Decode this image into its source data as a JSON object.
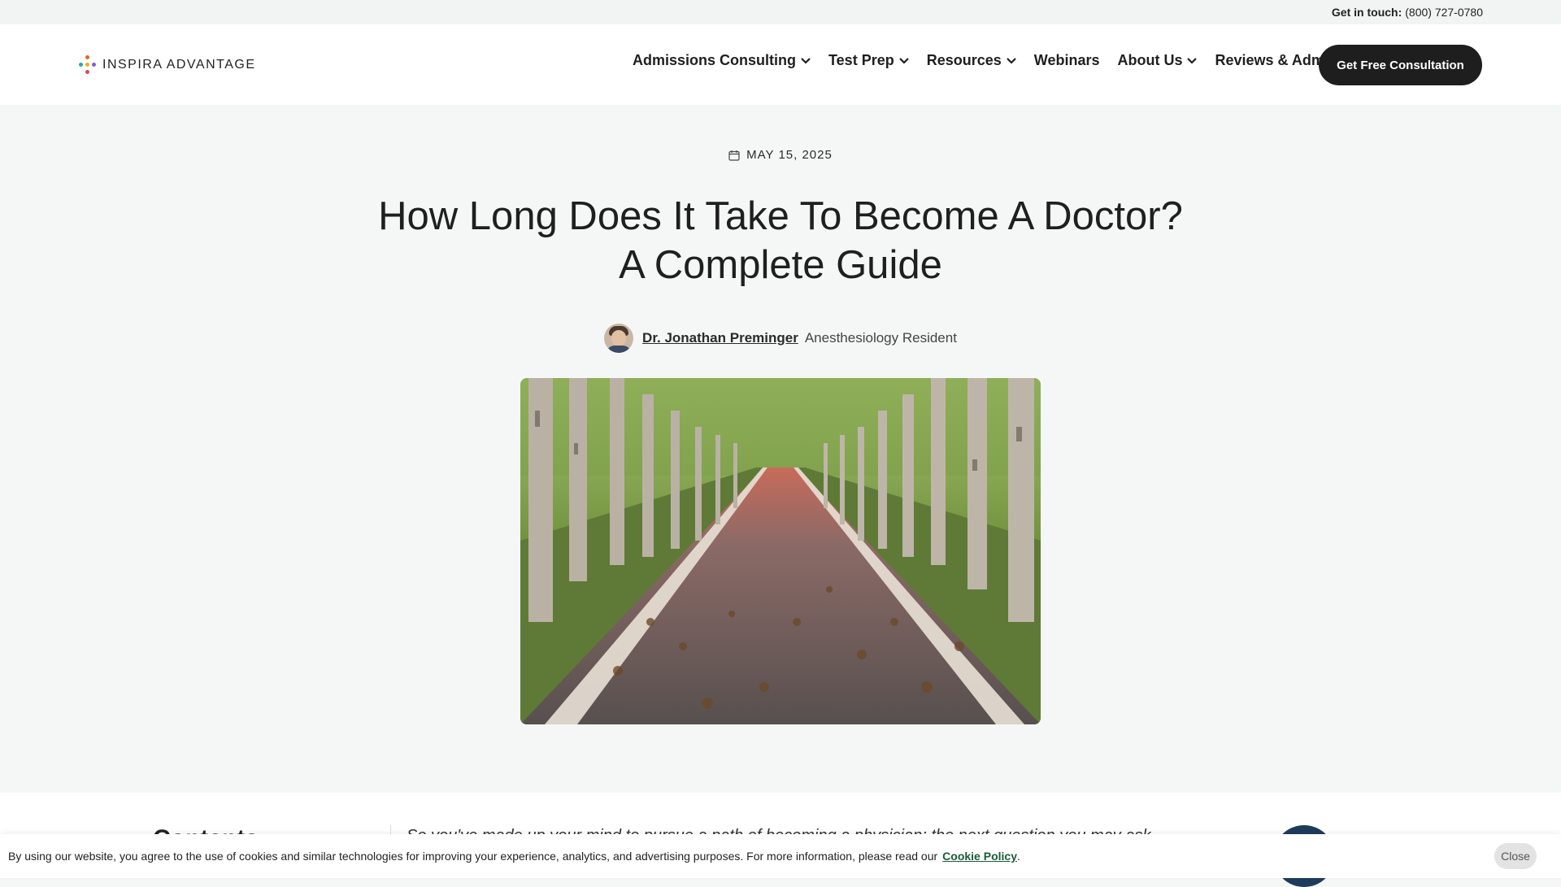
{
  "topbar": {
    "label": "Get in touch:",
    "phone": "(800) 727-0780"
  },
  "brand": {
    "name": "INSPIRA ADVANTAGE"
  },
  "nav": {
    "items": [
      {
        "label": "Admissions Consulting",
        "has_dropdown": true
      },
      {
        "label": "Test Prep",
        "has_dropdown": true
      },
      {
        "label": "Resources",
        "has_dropdown": true
      },
      {
        "label": "Webinars",
        "has_dropdown": false
      },
      {
        "label": "About Us",
        "has_dropdown": true
      },
      {
        "label": "Reviews & Admits",
        "has_dropdown": true
      }
    ],
    "cta_label": "Get Free Consultation"
  },
  "article": {
    "date": "MAY 15, 2025",
    "title": "How Long Does It Take To Become A Doctor? A Complete Guide",
    "author_name": "Dr. Jonathan Preminger",
    "author_role": "Anesthesiology Resident"
  },
  "content": {
    "toc_title": "Contents",
    "intro_text": "So you've made up your mind to pursue a path of becoming a physician: the next question you may ask"
  },
  "cookie": {
    "message": "By using our website, you agree to the use of cookies and similar technologies for improving your experience, analytics, and advertising purposes. For more information, please read our",
    "link_label": "Cookie Policy",
    "period": ".",
    "close_label": "Close"
  },
  "colors": {
    "page_bg": "#f5f7f6",
    "cta_bg": "#1e1e1e",
    "link_green": "#1a5c3a"
  },
  "icons": {
    "date": "calendar-icon",
    "dropdown": "chevron-down-icon"
  }
}
